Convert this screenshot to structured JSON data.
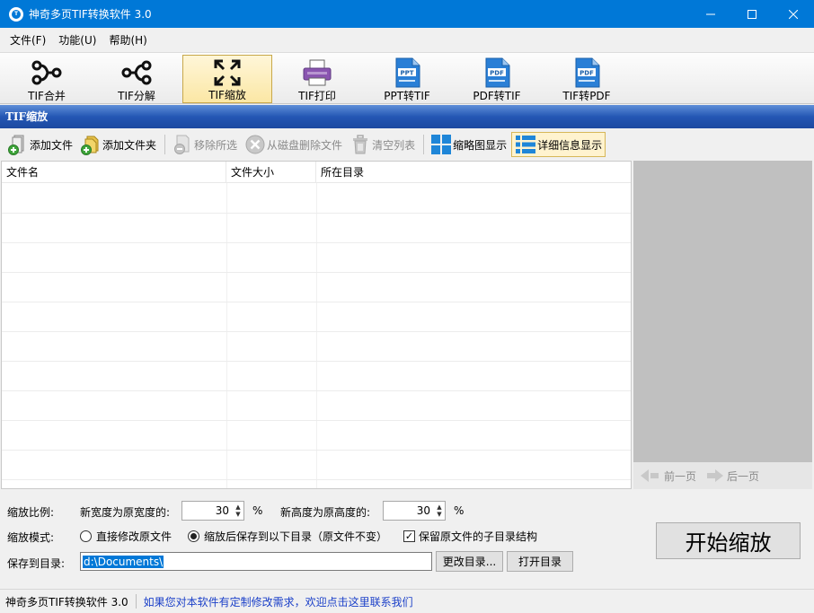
{
  "window": {
    "title": "神奇多页TIF转换软件 3.0",
    "minimize": "—",
    "maximize": "☐",
    "close": "✕"
  },
  "menu": [
    "文件(F)",
    "功能(U)",
    "帮助(H)"
  ],
  "main_toolbar": [
    {
      "label": "TIF合并",
      "icon": "merge-icon"
    },
    {
      "label": "TIF分解",
      "icon": "split-icon"
    },
    {
      "label": "TIF缩放",
      "icon": "resize-icon",
      "active": true
    },
    {
      "label": "TIF打印",
      "icon": "printer-icon"
    },
    {
      "label": "PPT转TIF",
      "icon": "ppt-file-icon",
      "badge": "PPT"
    },
    {
      "label": "PDF转TIF",
      "icon": "pdf-file-icon",
      "badge": "PDF"
    },
    {
      "label": "TIF转PDF",
      "icon": "pdf-file-icon",
      "badge": "PDF"
    }
  ],
  "section_title": "TIF缩放",
  "file_toolbar": {
    "add_file": "添加文件",
    "add_folder": "添加文件夹",
    "remove_selected": "移除所选",
    "delete_from_disk": "从磁盘删除文件",
    "clear_list": "清空列表",
    "thumbnail_view": "缩略图显示",
    "detail_view": "详细信息显示"
  },
  "file_list": {
    "columns": [
      "文件名",
      "文件大小",
      "所在目录"
    ],
    "rows": []
  },
  "pager": {
    "prev": "前一页",
    "next": "后一页"
  },
  "options": {
    "scale_label": "缩放比例:",
    "width_label": "新宽度为原宽度的:",
    "width_value": "30",
    "height_label": "新高度为原高度的:",
    "height_value": "30",
    "percent": "%",
    "mode_label": "缩放模式:",
    "mode_direct": "直接修改原文件",
    "mode_save": "缩放后保存到以下目录（原文件不变）",
    "keep_structure": "保留原文件的子目录结构",
    "save_label": "保存到目录:",
    "save_path": "d:\\Documents\\",
    "change_dir": "更改目录...",
    "open_dir": "打开目录",
    "start": "开始缩放"
  },
  "status": {
    "version": "神奇多页TIF转换软件 3.0",
    "link": "如果您对本软件有定制修改需求，欢迎点击这里联系我们"
  }
}
